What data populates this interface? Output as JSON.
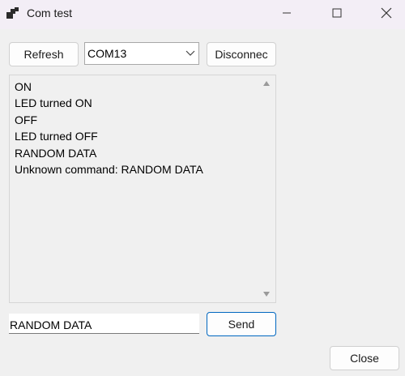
{
  "window": {
    "title": "Com test"
  },
  "toolbar": {
    "refresh_label": "Refresh",
    "port_value": "COM13",
    "disconnect_label": "Disconnec"
  },
  "log": {
    "lines": [
      "ON",
      "LED turned ON",
      "OFF",
      "LED turned OFF",
      "RANDOM DATA",
      "Unknown command: RANDOM DATA"
    ]
  },
  "send_row": {
    "input_value": "RANDOM DATA",
    "send_label": "Send"
  },
  "footer": {
    "close_label": "Close"
  },
  "colors": {
    "accent": "#0067c0",
    "titlebar": "#f3eef6"
  }
}
